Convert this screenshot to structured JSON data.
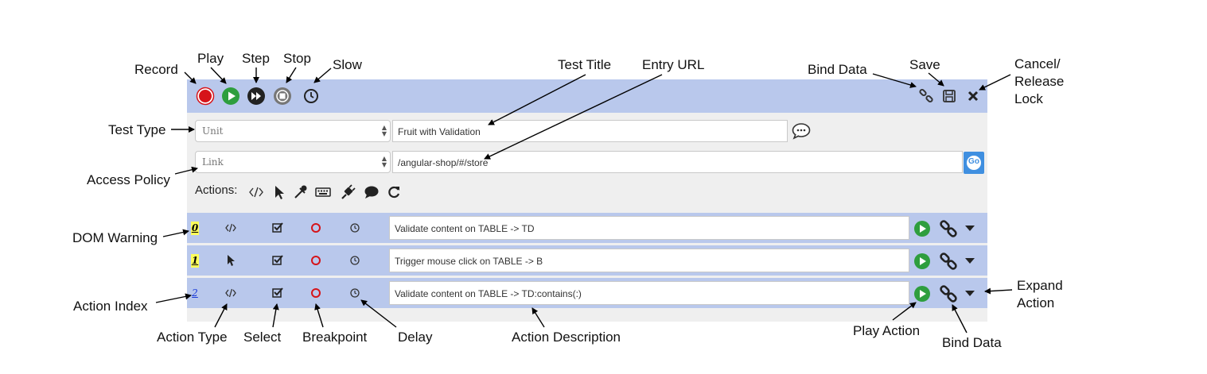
{
  "annotations": {
    "record": "Record",
    "play": "Play",
    "step": "Step",
    "stop": "Stop",
    "slow": "Slow",
    "test_title": "Test Title",
    "entry_url": "Entry URL",
    "bind_data_top": "Bind Data",
    "save": "Save",
    "cancel_release_lock": "Cancel/ Release Lock",
    "test_type": "Test Type",
    "access_policy": "Access Policy",
    "dom_warning": "DOM Warning",
    "action_index": "Action Index",
    "action_type": "Action Type",
    "select": "Select",
    "breakpoint": "Breakpoint",
    "delay": "Delay",
    "action_description": "Action Description",
    "play_action": "Play Action",
    "bind_data_bottom": "Bind Data",
    "expand_action": "Expand Action"
  },
  "toolbar": {
    "buttons": [
      "record-icon",
      "play-icon",
      "step-icon",
      "stop-icon",
      "slow-clock-icon"
    ],
    "right_buttons": [
      "bind-link-icon",
      "save-floppy-icon",
      "close-x-icon"
    ]
  },
  "form": {
    "test_type_value": "Unit",
    "test_title_value": "Fruit with Validation",
    "access_policy_value": "Link",
    "entry_url_value": "/angular-shop/#/store",
    "go_label": "Go"
  },
  "actions_bar": {
    "label": "Actions:",
    "icons": [
      "code-icon",
      "pointer-icon",
      "eyedropper-icon",
      "keyboard-icon",
      "plug-icon",
      "comment-icon",
      "refresh-icon"
    ]
  },
  "rows": [
    {
      "index": "0",
      "warning": true,
      "type_icon": "code-icon",
      "description": "Validate content on TABLE -> TD"
    },
    {
      "index": "1",
      "warning": true,
      "type_icon": "pointer-icon",
      "description": "Trigger mouse click on TABLE -> B"
    },
    {
      "index": "2",
      "warning": false,
      "type_icon": "code-icon",
      "description": "Validate content on TABLE -> TD:contains(:)"
    }
  ],
  "colors": {
    "toolbar_bg": "#b9c8ec",
    "panel_bg": "#efefef",
    "record_red": "#d6141a",
    "play_green": "#2e9e3e",
    "go_blue": "#3f8fe0",
    "warning_yellow": "#ffff5a"
  }
}
